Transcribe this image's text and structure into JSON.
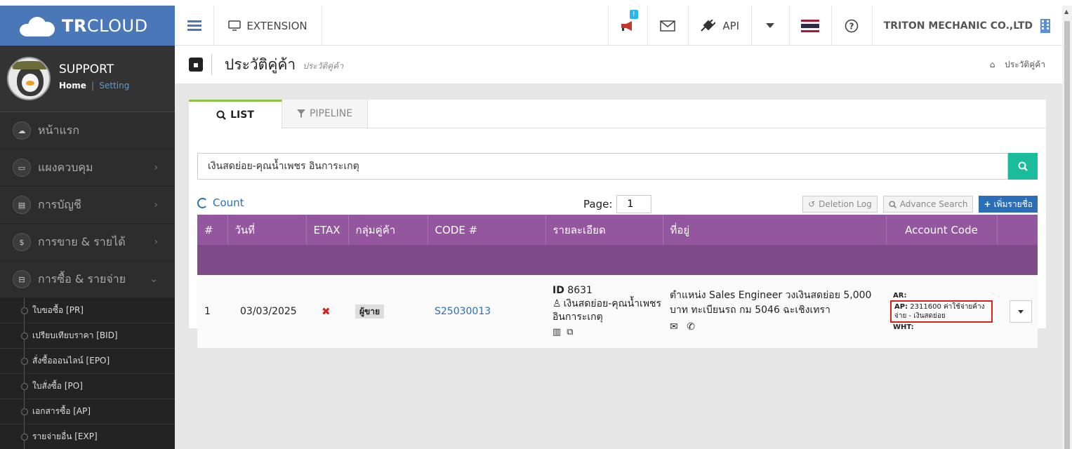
{
  "brand": {
    "bold": "TR",
    "rest": "CLOUD"
  },
  "profile": {
    "name": "SUPPORT",
    "home": "Home",
    "separator": "|",
    "setting": "Setting"
  },
  "menu": [
    {
      "label": "หน้าแรก",
      "icon": "cloud-icon",
      "glyph": "☁"
    },
    {
      "label": "แผงควบคุม",
      "icon": "monitor-icon",
      "glyph": "▭",
      "arrow": "›"
    },
    {
      "label": "การบัญชี",
      "icon": "book-icon",
      "glyph": "▤",
      "arrow": "›"
    },
    {
      "label": "การขาย & รายได้",
      "icon": "dollar-icon",
      "glyph": "$",
      "arrow": "›"
    },
    {
      "label": "การซื้อ & รายจ่าย",
      "icon": "cart-icon",
      "glyph": "⊟",
      "arrow": "⌄"
    }
  ],
  "submenu": [
    "ใบขอซื้อ [PR]",
    "เปรียบเทียบราคา [BID]",
    "สั่งซื้อออนไลน์ [EPO]",
    "ใบสั่งซื้อ [PO]",
    "เอกสารซื้อ [AP]",
    "รายจ่ายอื่น [EXP]"
  ],
  "topbar": {
    "extension": "EXTENSION",
    "notify_badge": "!",
    "api": "API",
    "company": "TRITON MECHANIC CO.,LTD"
  },
  "page": {
    "title": "ประวัติคู่ค้า",
    "subtitle": "ประวัติคู่ค้า",
    "breadcrumb": "ประวัติคู่ค้า"
  },
  "tabs": {
    "list": "LIST",
    "pipeline": "PIPELINE"
  },
  "search": {
    "value": "เงินสดย่อย-คุณน้ำเพชร อินการะเกตุ"
  },
  "count_label": "Count",
  "pager": {
    "label": "Page:",
    "value": "1"
  },
  "actions": {
    "deletion_log": "Deletion Log",
    "advance_search": "Advance Search",
    "add": "เพิ่มรายชื่อ"
  },
  "table": {
    "headers": [
      "#",
      "วันที่",
      "ETAX",
      "กลุ่มคู่ค้า",
      "CODE #",
      "รายละเอียด",
      "ที่อยู่",
      "Account Code",
      ""
    ],
    "rows": [
      {
        "num": "1",
        "date": "03/03/2025",
        "etax": "✖",
        "group": "ผู้ขาย",
        "code": "S25030013",
        "id_label": "ID",
        "id_value": "8631",
        "name": "เงินสดย่อย-คุณน้ำเพชร อินการะเกตุ",
        "address": "ตำแหน่ง Sales Engineer วงเงินสดย่อย 5,000 บาท ทะเบียนรถ กม 5046 ฉะเชิงเทรา",
        "ar_label": "AR:",
        "ap_label": "AP:",
        "ap_value": "2311600 ค่าใช้จ่ายค้างจ่าย - เงินสดย่อย",
        "wht_label": "WHT:"
      }
    ]
  },
  "colors": {
    "brand": "#4a77b8",
    "header_purple": "#94569e",
    "accent_green": "#1abc9c",
    "link_blue": "#2a6fb8",
    "highlight_red": "#d9221c"
  }
}
